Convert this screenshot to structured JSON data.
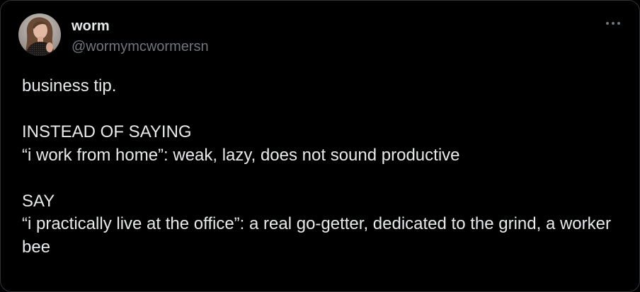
{
  "author": {
    "display_name": "worm",
    "handle": "@wormymcwormersn",
    "avatar": "avatar-photo"
  },
  "more_icon": "more-horizontal-icon",
  "tweet": {
    "lines": [
      "business tip.",
      "INSTEAD OF SAYING",
      "“i work from home”: weak, lazy, does not sound productive",
      "SAY",
      "“i practically live at the office”: a real go-getter, dedicated to the grind, a worker bee"
    ]
  },
  "colors": {
    "background": "#000000",
    "text": "#e7e9ea",
    "secondary_text": "#71767b",
    "border": "#2f3336"
  }
}
